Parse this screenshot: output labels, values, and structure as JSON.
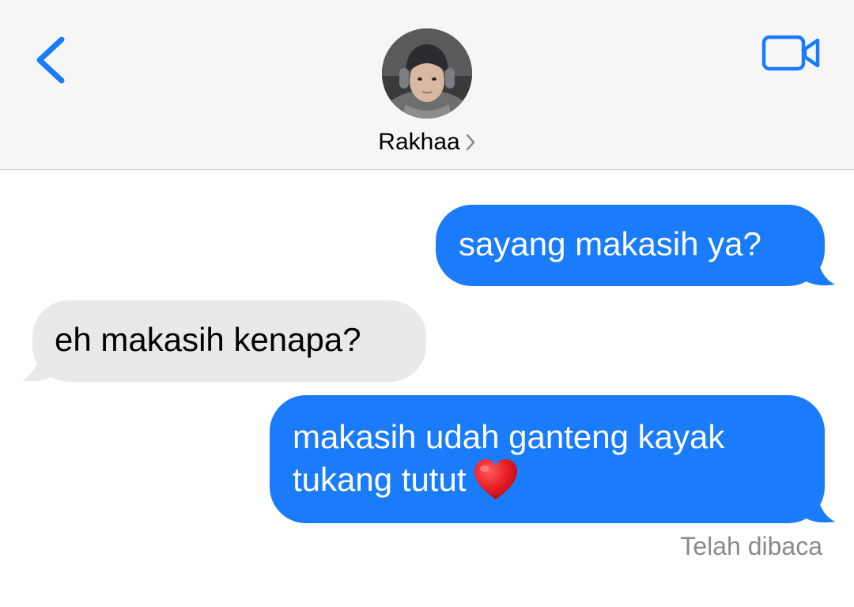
{
  "header": {
    "back_icon": "chevron-left-icon",
    "video_icon": "video-camera-icon",
    "contact_name": "Rakhaa",
    "name_chevron_icon": "chevron-right-icon",
    "accent_color": "#1a7cfa"
  },
  "messages": [
    {
      "direction": "outgoing",
      "text": "sayang makasih ya?"
    },
    {
      "direction": "incoming",
      "text": "eh makasih kenapa?"
    },
    {
      "direction": "outgoing",
      "text": "makasih udah ganteng kayak\ntukang tutut",
      "emoji": "red-heart-icon"
    }
  ],
  "read_status": "Telah dibaca",
  "colors": {
    "outgoing_bubble": "#1a7cfa",
    "incoming_bubble": "#e9e9eb",
    "header_bg": "#f6f6f6",
    "status_text": "#8a8a8e"
  }
}
